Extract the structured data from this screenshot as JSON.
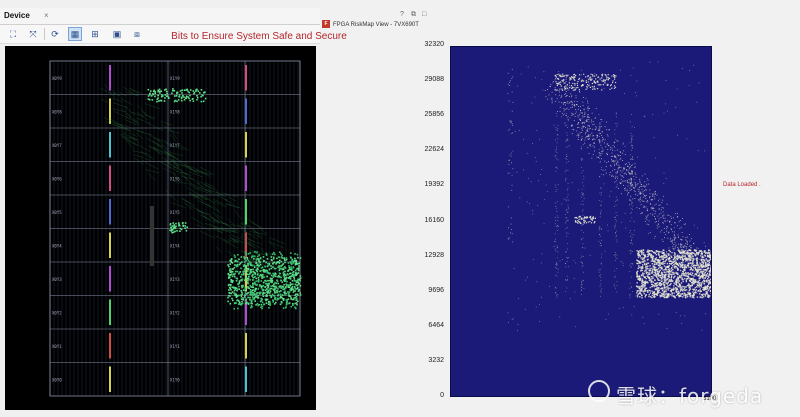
{
  "device_panel": {
    "tab_label": "Device",
    "close_glyph": "×",
    "toolbar": {
      "icons": [
        "fit-icon",
        "zoom-fit-icon",
        "refresh-icon",
        "select-icon",
        "route-icon",
        "show-cells-icon",
        "show-nets-icon"
      ]
    },
    "region_labels": [
      "X0Y9",
      "X1Y9",
      "X0Y8",
      "X1Y8",
      "X0Y7",
      "X1Y7",
      "X0Y6",
      "X1Y6",
      "X0Y5",
      "X1Y5",
      "X0Y4",
      "X1Y4",
      "X0Y3",
      "X1Y3",
      "X0Y2",
      "X1Y2",
      "X0Y1",
      "X1Y1",
      "X0Y0",
      "X1Y0"
    ]
  },
  "riskmap_window": {
    "title": "FPGA RiskMap View - 7VX690T",
    "app_icon_text": "F",
    "controls": [
      "?",
      "⧉",
      "□"
    ],
    "status_text": "Data Loaded .",
    "colors": {
      "plot_bg": "#1b1a78",
      "title": "#b3262b",
      "points": "#e8e8d4"
    }
  },
  "chart_data": {
    "type": "scatter",
    "title": "Bits to Ensure System Safe and Secure",
    "xlabel": "",
    "ylabel": "",
    "x_tick_labels": [
      "5100"
    ],
    "y_tick_labels": [
      "0",
      "3232",
      "6464",
      "9696",
      "12928",
      "16160",
      "19392",
      "22624",
      "25856",
      "29088",
      "32320"
    ],
    "xlim": [
      0,
      5100
    ],
    "ylim": [
      0,
      32320
    ],
    "grid": false,
    "legend": "none",
    "series": [
      {
        "clusters": [
          {
            "x_range": [
              3600,
              5100
            ],
            "y_range": [
              9300,
              13700
            ]
          },
          {
            "x_range": [
              2000,
              3200
            ],
            "y_range": [
              28400,
              29900
            ]
          },
          {
            "x_range": [
              2400,
              2800
            ],
            "y_range": [
              16100,
              16800
            ]
          },
          {
            "x_range": [
              2000,
              5000
            ],
            "y_range": [
              9300,
              29000
            ],
            "pattern": "diagonal"
          },
          {
            "x_range": [
              1100,
              1200
            ],
            "y_range": [
              14000,
              30500
            ],
            "pattern": "column"
          }
        ]
      }
    ]
  },
  "watermark": {
    "text": "雪球：forgeda"
  }
}
